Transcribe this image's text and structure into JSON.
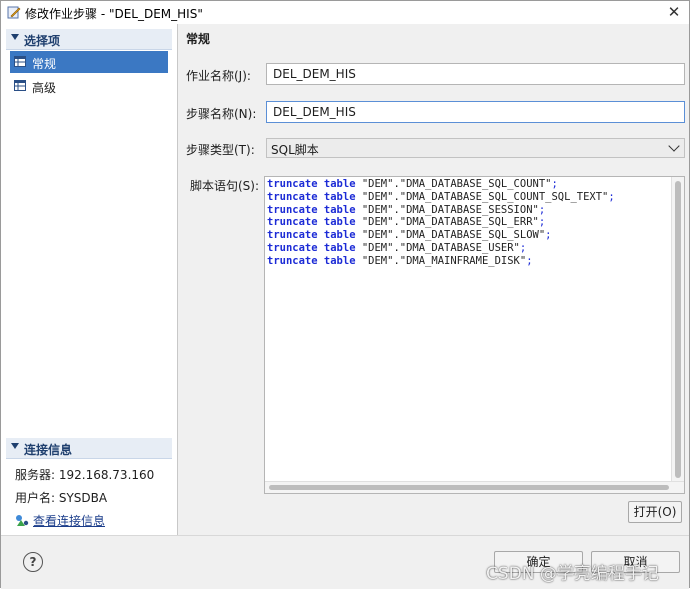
{
  "window": {
    "title": "修改作业步骤 - \"DEL_DEM_HIS\"",
    "close_glyph": "✕"
  },
  "sidebar": {
    "options_header": "选择项",
    "items": [
      {
        "label": "常规",
        "icon": "table-icon",
        "active": true
      },
      {
        "label": "高级",
        "icon": "table-icon",
        "active": false
      }
    ],
    "connection_header": "连接信息",
    "server": "服务器: 192.168.73.160",
    "user": "用户名: SYSDBA",
    "view_link": "查看连接信息"
  },
  "main": {
    "section_title": "常规",
    "job_name": {
      "label": "作业名称(J):",
      "value": "DEL_DEM_HIS"
    },
    "step_name": {
      "label": "步骤名称(N):",
      "value": "DEL_DEM_HIS"
    },
    "step_type": {
      "label": "步骤类型(T):",
      "value": "SQL脚本"
    },
    "script": {
      "label": "脚本语句(S):",
      "lines": [
        {
          "kw1": "truncate",
          "kw2": "table",
          "rest": "\"DEM\".\"DMA_DATABASE_SQL_COUNT\"",
          "semi": ";"
        },
        {
          "kw1": "truncate",
          "kw2": "table",
          "rest": "\"DEM\".\"DMA_DATABASE_SQL_COUNT_SQL_TEXT\"",
          "semi": ";"
        },
        {
          "kw1": "truncate",
          "kw2": "table",
          "rest": "\"DEM\".\"DMA_DATABASE_SESSION\"",
          "semi": ";"
        },
        {
          "kw1": "truncate",
          "kw2": "table",
          "rest": "\"DEM\".\"DMA_DATABASE_SQL_ERR\"",
          "semi": ";"
        },
        {
          "kw1": "truncate",
          "kw2": "table",
          "rest": "\"DEM\".\"DMA_DATABASE_SQL_SLOW\"",
          "semi": ";"
        },
        {
          "kw1": "truncate",
          "kw2": "table",
          "rest": "\"DEM\".\"DMA_DATABASE_USER\"",
          "semi": ";"
        },
        {
          "kw1": "truncate",
          "kw2": "table",
          "rest": "\"DEM\".\"DMA_MAINFRAME_DISK\"",
          "semi": ";"
        }
      ]
    },
    "open_button": "打开(O)"
  },
  "footer": {
    "help": "?",
    "ok_button": "确定",
    "cancel_button": "取消"
  },
  "watermark": "CSDN @学亮编程手记",
  "colors": {
    "keyword": "#1c2bd6",
    "active_item": "#3b78c3",
    "section_header": "#e7edf5"
  }
}
